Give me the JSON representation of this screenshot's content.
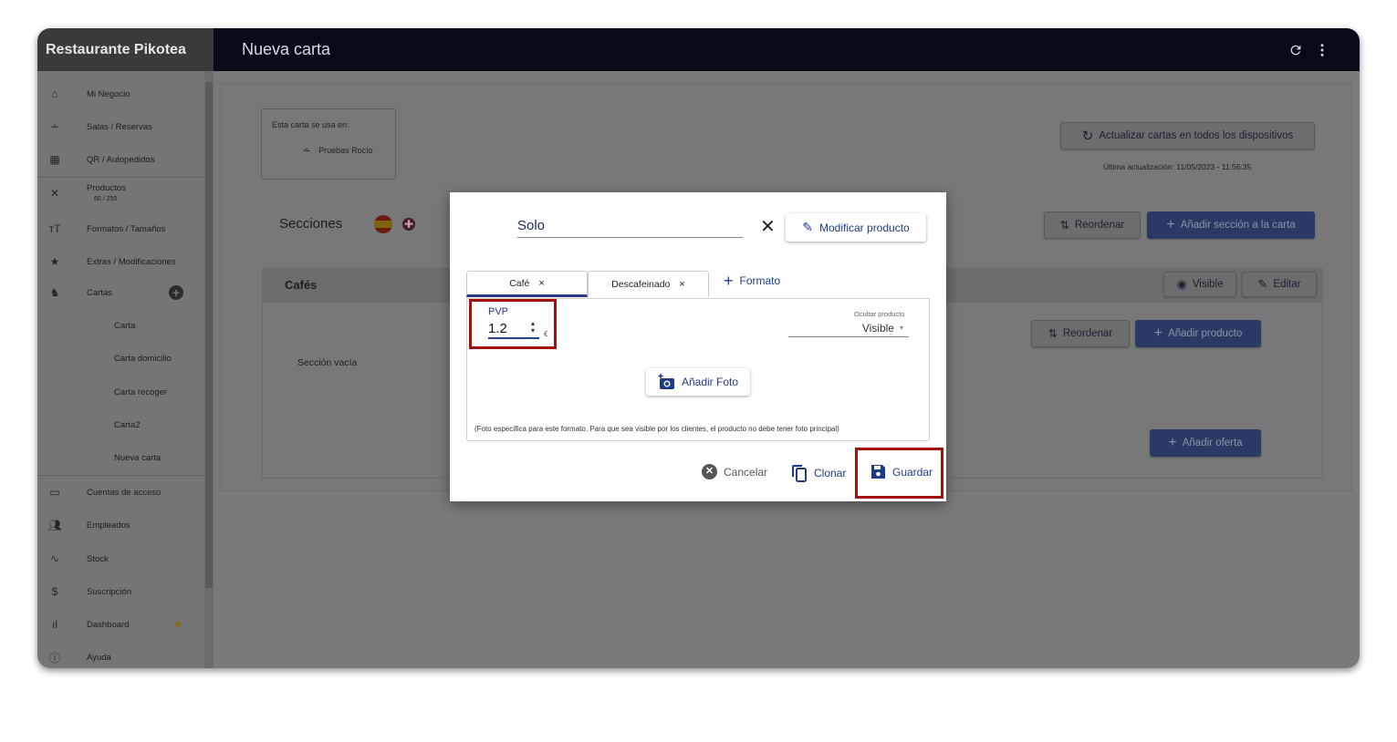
{
  "app": {
    "name": "Restaurante Pikotea",
    "page_title": "Nueva carta"
  },
  "topbar": {
    "refresh_icon": "refresh-icon",
    "menu_icon": "more-vert-icon"
  },
  "sidebar": {
    "items": [
      {
        "icon": "home-icon",
        "label": "Mi Negocio"
      },
      {
        "icon": "table-icon",
        "label": "Salas / Reservas"
      },
      {
        "icon": "qr-icon",
        "label": "QR / Autopedidos"
      },
      {
        "icon": "utensils-icon",
        "label": "Productos",
        "sublabel": "60 / 250"
      },
      {
        "icon": "text-size-icon",
        "label": "Formatos / Tamaños"
      },
      {
        "icon": "star-icon",
        "label": "Extras / Modificaciones"
      },
      {
        "icon": "menu-book-icon",
        "label": "Cartas"
      },
      {
        "label": "Carta"
      },
      {
        "label": "Carta domicilio"
      },
      {
        "label": "Carta recoger"
      },
      {
        "label": "Carta2"
      },
      {
        "label": "Nueva carta"
      },
      {
        "icon": "devices-icon",
        "label": "Cuentas de acceso"
      },
      {
        "icon": "people-icon",
        "label": "Empleados"
      },
      {
        "icon": "trend-icon",
        "label": "Stock"
      },
      {
        "icon": "dollar-icon",
        "label": "Suscripción"
      },
      {
        "icon": "bar-chart-icon",
        "label": "Dashboard"
      },
      {
        "icon": "help-icon",
        "label": "Ayuda"
      }
    ]
  },
  "main": {
    "uso_label": "Esta carta se usa en:",
    "uso_value": "Pruebas Rocío",
    "update_button": "Actualizar cartas en todos los dispositivos",
    "last_update": "Última actualización:  11/05/2023 - 11:56:35",
    "sections_title": "Secciones",
    "reorder_sections": "Reordenar",
    "add_section": "Añadir sección a la carta",
    "section_name": "Cafés",
    "visible_button": "Visible",
    "edit_button": "Editar",
    "empty_section": "Sección vacía",
    "reorder_products": "Reordenar",
    "add_product": "Añadir producto",
    "add_offer": "Añadir oferta"
  },
  "modal": {
    "product_name": "Solo",
    "modify_button": "Modificar producto",
    "tabs": [
      {
        "label": "Café"
      },
      {
        "label": "Descafeinado"
      }
    ],
    "add_format": "Formato",
    "pvp_label": "PVP",
    "pvp_value": "1.2",
    "currency": "€",
    "hide_label": "Ocultar producto",
    "hide_value": "Visible",
    "add_photo": "Añadir Foto",
    "photo_note": "(Foto específica para este formato. Para que sea visible por los clientes, el producto no debe tener foto principal)",
    "cancel": "Cancelar",
    "clone": "Clonar",
    "save": "Guardar"
  },
  "colors": {
    "highlight": "#a50f10",
    "accent": "#283e8c",
    "topbar": "#070a18"
  }
}
